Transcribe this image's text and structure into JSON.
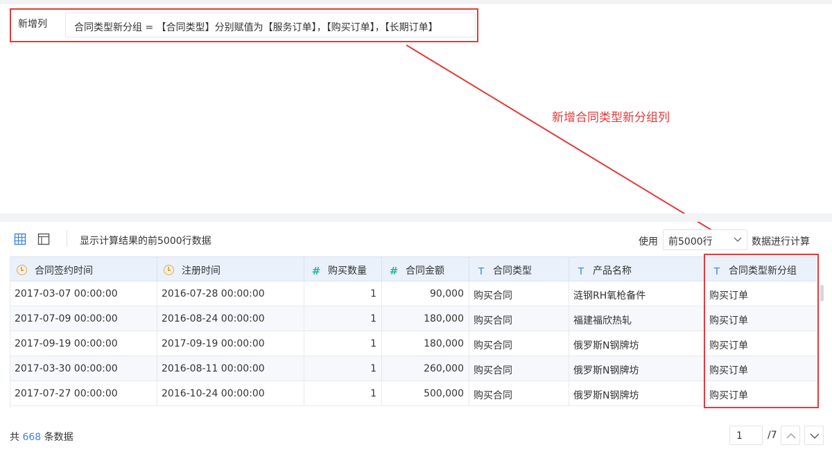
{
  "formula": {
    "label": "新增列",
    "expression": "合同类型新分组 = 【合同类型】分别赋值为【服务订单】，【购买订单】，【长期订单】"
  },
  "annotation": "新增合同类型新分组列",
  "toolbar": {
    "info": "显示计算结果的前5000行数据",
    "use_label": "使用",
    "row_limit": "前5000行",
    "calc_label": "数据进行计算"
  },
  "table": {
    "columns": [
      {
        "label": "合同签约时间",
        "icon": "clock-icon"
      },
      {
        "label": "注册时间",
        "icon": "clock-icon"
      },
      {
        "label": "购买数量",
        "icon": "hash-icon",
        "glyph": "#"
      },
      {
        "label": "合同金额",
        "icon": "hash-icon",
        "glyph": "#"
      },
      {
        "label": "合同类型",
        "icon": "text-type-icon",
        "glyph": "T"
      },
      {
        "label": "产品名称",
        "icon": "text-type-icon",
        "glyph": "T"
      },
      {
        "label": "合同类型新分组",
        "icon": "text-type-icon",
        "glyph": "T"
      }
    ],
    "rows": [
      [
        "2017-03-07 00:00:00",
        "2016-07-28 00:00:00",
        "1",
        "90,000",
        "购买合同",
        "涟钢RH氧枪备件",
        "购买订单"
      ],
      [
        "2017-07-09 00:00:00",
        "2016-08-24 00:00:00",
        "1",
        "180,000",
        "购买合同",
        "福建福欣热轧",
        "购买订单"
      ],
      [
        "2017-09-19 00:00:00",
        "2017-09-19 00:00:00",
        "1",
        "180,000",
        "购买合同",
        "俄罗斯N钢牌坊",
        "购买订单"
      ],
      [
        "2017-03-30 00:00:00",
        "2016-08-11 00:00:00",
        "1",
        "260,000",
        "购买合同",
        "俄罗斯N钢牌坊",
        "购买订单"
      ],
      [
        "2017-07-27 00:00:00",
        "2016-10-24 00:00:00",
        "1",
        "500,000",
        "购买合同",
        "俄罗斯N钢牌坊",
        "购买订单"
      ]
    ]
  },
  "footer": {
    "total_prefix": "共",
    "total_count": "668",
    "total_suffix": "条数据",
    "current_page": "1",
    "page_total": "/7"
  },
  "colors": {
    "highlight": "#e5393a",
    "accent": "#3e82e5",
    "header_bg": "#eaf1fb"
  }
}
